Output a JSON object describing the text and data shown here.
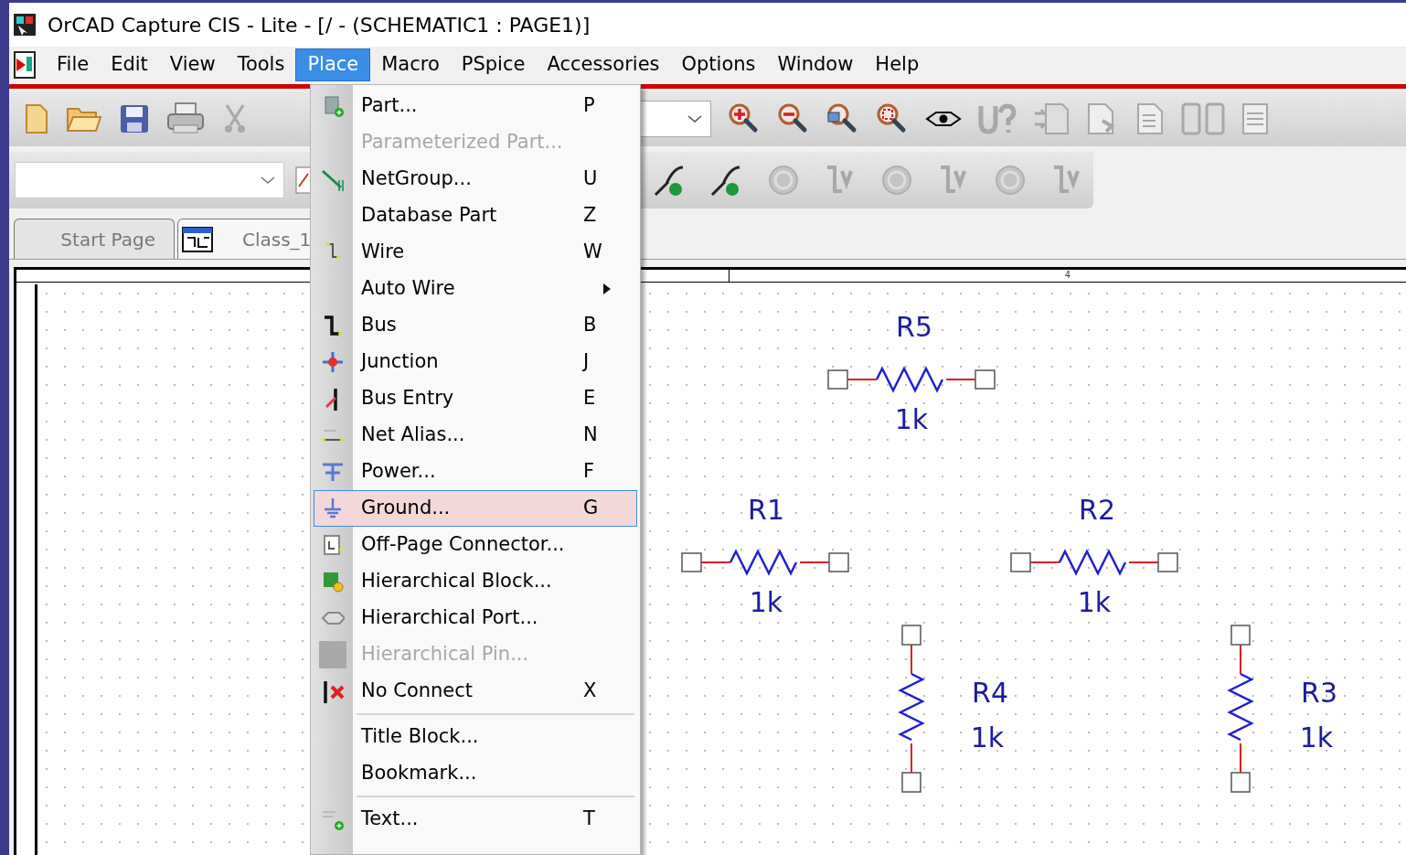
{
  "window": {
    "title": "OrCAD Capture CIS - Lite - [/ - (SCHEMATIC1 : PAGE1)]"
  },
  "menubar": [
    {
      "label": "File",
      "selected": false
    },
    {
      "label": "Edit",
      "selected": false
    },
    {
      "label": "View",
      "selected": false
    },
    {
      "label": "Tools",
      "selected": false
    },
    {
      "label": "Place",
      "selected": true
    },
    {
      "label": "Macro",
      "selected": false
    },
    {
      "label": "PSpice",
      "selected": false
    },
    {
      "label": "Accessories",
      "selected": false
    },
    {
      "label": "Options",
      "selected": false
    },
    {
      "label": "Window",
      "selected": false
    },
    {
      "label": "Help",
      "selected": false
    }
  ],
  "tabs": [
    {
      "label": "Start Page",
      "selected": false
    },
    {
      "label": "Class_1",
      "selected": true
    }
  ],
  "ruler": {
    "label": "4"
  },
  "parts": [
    {
      "kind": "horizontal",
      "ref": "R5",
      "value": "1k"
    },
    {
      "kind": "horizontal",
      "ref": "R1",
      "value": "1k"
    },
    {
      "kind": "horizontal",
      "ref": "R2",
      "value": "1k"
    },
    {
      "kind": "vertical",
      "ref": "R4",
      "value": "1k"
    },
    {
      "kind": "vertical",
      "ref": "R3",
      "value": "1k"
    }
  ],
  "place_menu": [
    {
      "kind": "item",
      "label": "Part...",
      "shortcut": "P",
      "disabled": false,
      "selected": false
    },
    {
      "kind": "item",
      "label": "Parameterized Part...",
      "disabled": true,
      "selected": false
    },
    {
      "kind": "item",
      "label": "NetGroup...",
      "shortcut": "U",
      "disabled": false,
      "selected": false
    },
    {
      "kind": "item",
      "label": "Database Part",
      "shortcut": "Z",
      "disabled": false,
      "selected": false
    },
    {
      "kind": "item",
      "label": "Wire",
      "shortcut": "W",
      "disabled": false,
      "selected": false
    },
    {
      "kind": "submenu",
      "label": "Auto Wire",
      "disabled": false,
      "selected": false
    },
    {
      "kind": "item",
      "label": "Bus",
      "shortcut": "B",
      "disabled": false,
      "selected": false
    },
    {
      "kind": "item",
      "label": "Junction",
      "shortcut": "J",
      "disabled": false,
      "selected": false
    },
    {
      "kind": "item",
      "label": "Bus Entry",
      "shortcut": "E",
      "disabled": false,
      "selected": false
    },
    {
      "kind": "item",
      "label": "Net Alias...",
      "shortcut": "N",
      "disabled": false,
      "selected": false
    },
    {
      "kind": "item",
      "label": "Power...",
      "shortcut": "F",
      "disabled": false,
      "selected": false
    },
    {
      "kind": "item",
      "label": "Ground...",
      "shortcut": "G",
      "disabled": false,
      "selected": true
    },
    {
      "kind": "item",
      "label": "Off-Page Connector...",
      "disabled": false,
      "selected": false
    },
    {
      "kind": "item",
      "label": "Hierarchical Block...",
      "disabled": false,
      "selected": false
    },
    {
      "kind": "item",
      "label": "Hierarchical Port...",
      "disabled": false,
      "selected": false
    },
    {
      "kind": "item",
      "label": "Hierarchical Pin...",
      "disabled": true,
      "selected": false
    },
    {
      "kind": "item",
      "label": "No Connect",
      "shortcut": "X",
      "disabled": false,
      "selected": false
    },
    {
      "kind": "separator"
    },
    {
      "kind": "item",
      "label": "Title Block...",
      "disabled": false,
      "selected": false
    },
    {
      "kind": "item",
      "label": "Bookmark...",
      "disabled": false,
      "selected": false
    },
    {
      "kind": "separator"
    },
    {
      "kind": "item",
      "label": "Text...",
      "shortcut": "T",
      "disabled": false,
      "selected": false
    }
  ]
}
